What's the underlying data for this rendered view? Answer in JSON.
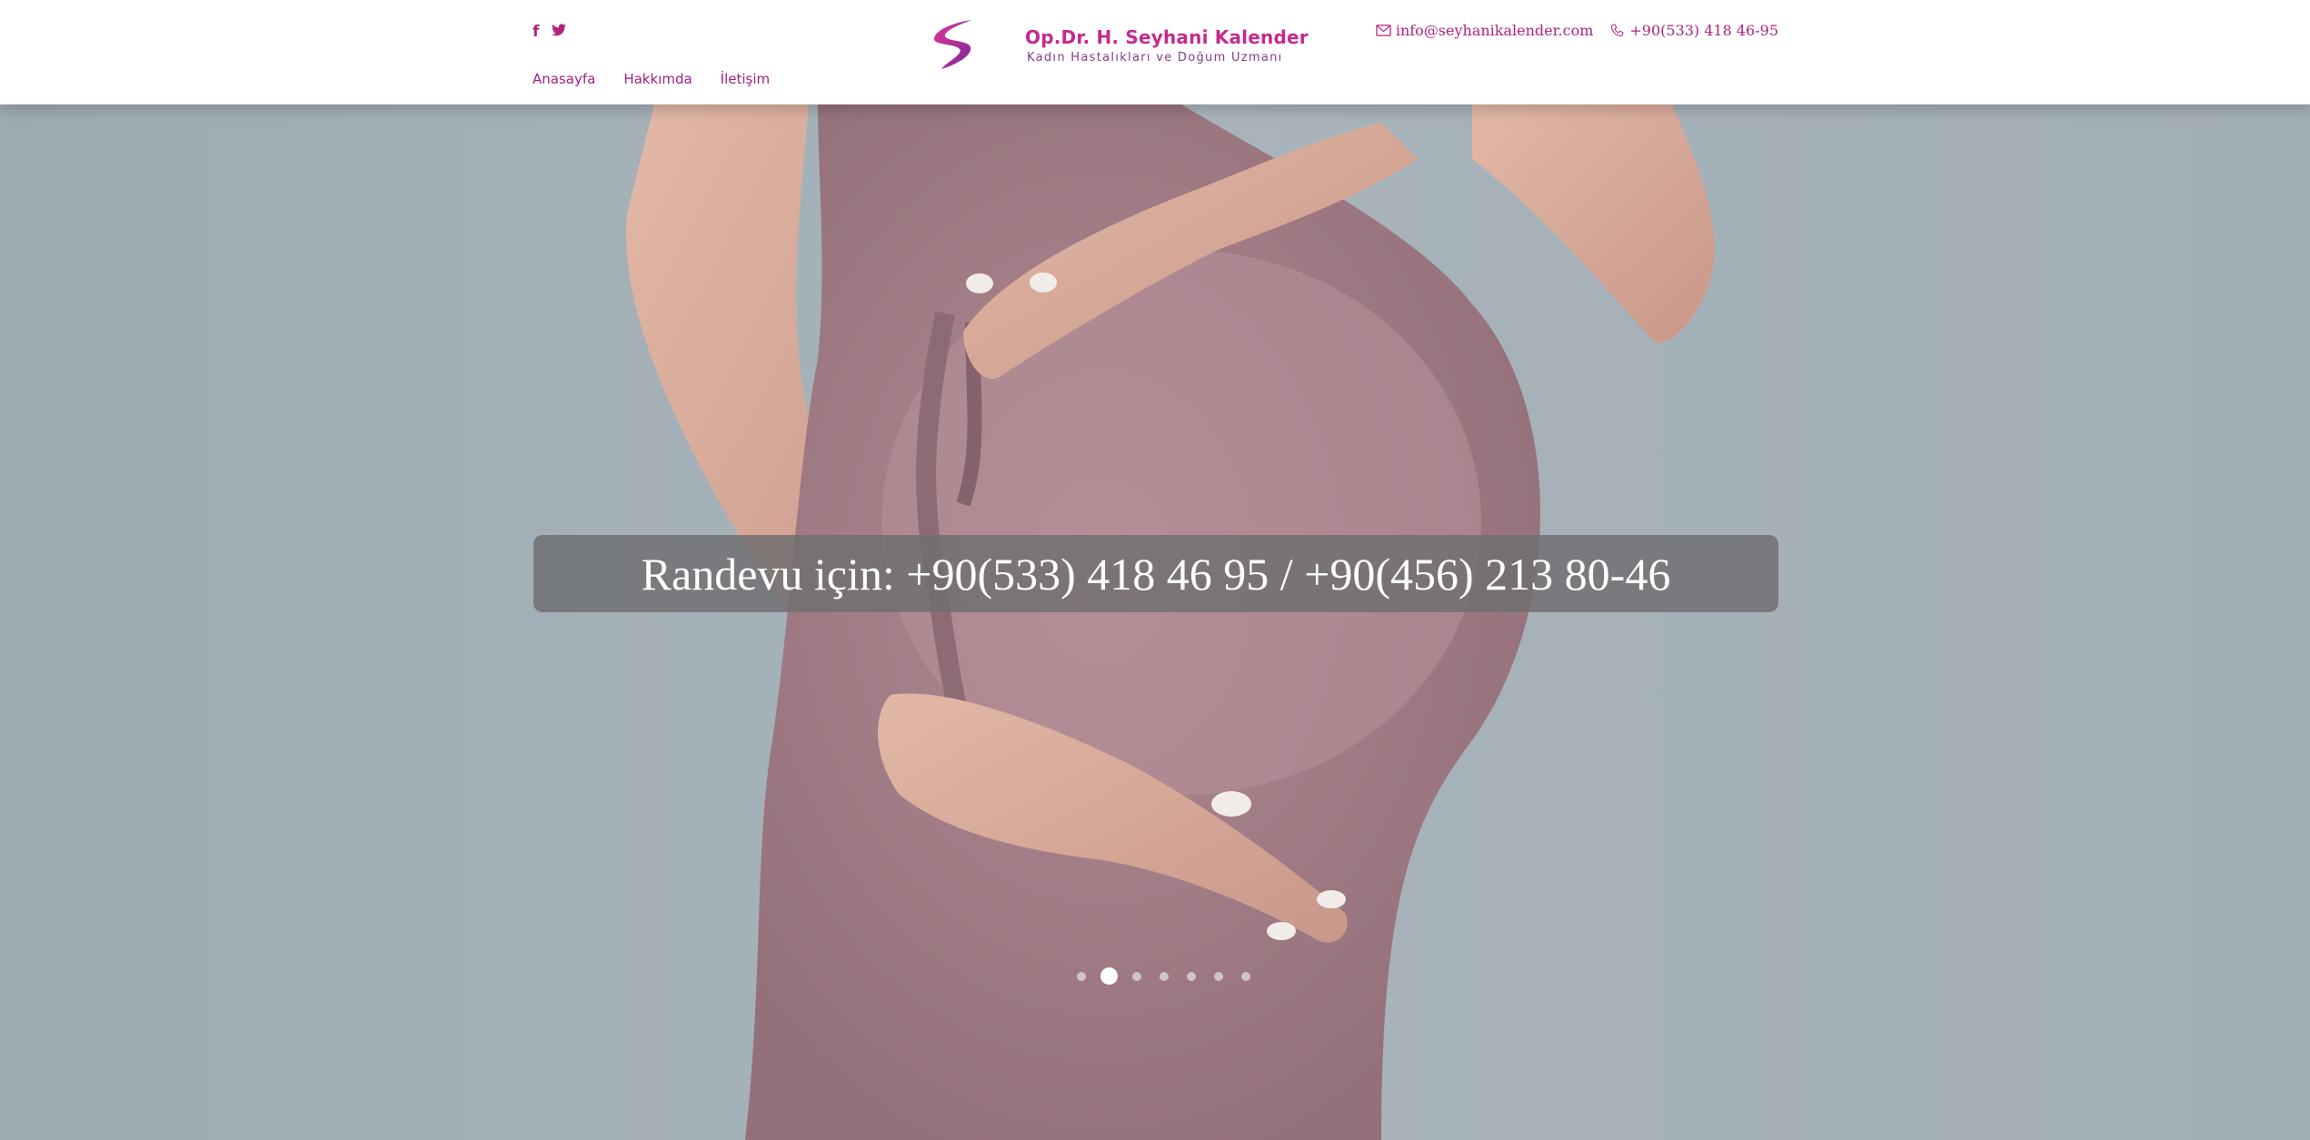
{
  "header": {
    "social": [
      {
        "icon": "facebook-icon",
        "glyph": "f"
      },
      {
        "icon": "twitter-icon",
        "glyph": "✦"
      }
    ],
    "nav": [
      {
        "label": "Anasayfa"
      },
      {
        "label": "Hakkımda"
      },
      {
        "label": "İletişim"
      }
    ],
    "logo": {
      "title": "Op.Dr. H. Seyhani Kalender",
      "subtitle": "Kadın Hastalıkları ve Doğum Uzmanı"
    },
    "contact": {
      "email": "info@seyhanikalender.com",
      "phone": "+90(533) 418 46-95"
    }
  },
  "hero": {
    "banner_text": "Randevu için: +90(533) 418 46 95 / +90(456) 213 80-46",
    "slides_count": 7,
    "active_slide": 2
  },
  "colors": {
    "brand": "#b0227f",
    "banner_bg": "#6e6e70",
    "dress": "#a27880"
  }
}
